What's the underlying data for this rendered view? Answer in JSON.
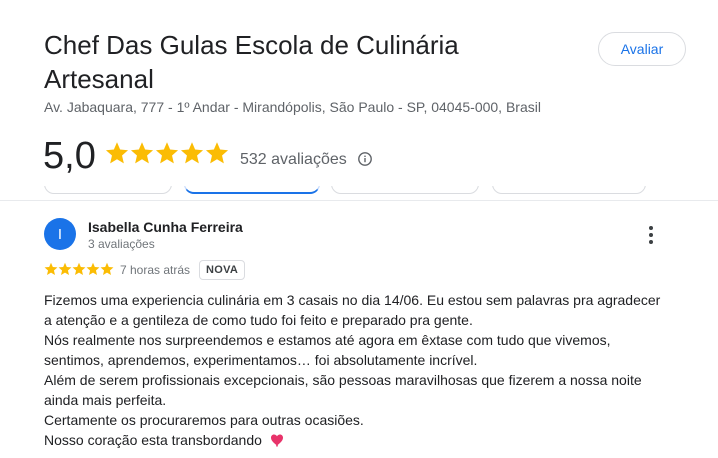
{
  "place": {
    "name_line1": "Chef Das Gulas Escola de Culinária",
    "name_line2": "Artesanal",
    "address": "Av. Jabaquara, 777 - 1º Andar - Mirandópolis, São Paulo - SP, 04045-000, Brasil",
    "rate_button_label": "Avaliar"
  },
  "rating": {
    "score": "5,0",
    "stars": 5,
    "count_label": "532 avaliações",
    "star_color": "#fbbc04"
  },
  "review": {
    "avatar_letter": "I",
    "avatar_color": "#1a73e8",
    "reviewer_name": "Isabella Cunha Ferreira",
    "reviewer_reviews": "3 avaliações",
    "stars": 5,
    "time": "7 horas atrás",
    "badge": "NOVA",
    "lines": [
      "Fizemos uma experiencia culinária em 3 casais no dia 14/06. Eu estou sem palavras pra agradecer",
      "a atenção e a gentileza de como tudo foi feito e preparado pra gente.",
      "Nós realmente nos surpreendemos e estamos até agora em êxtase com tudo que vivemos,",
      "sentimos, aprendemos, experimentamos… foi absolutamente incrível.",
      "Além de serem profissionais excepcionais, são pessoas maravilhosas que fizerem a nossa noite",
      "ainda mais perfeita.",
      "Certamente os procuraremos para outras ocasiões.",
      "Nosso coração esta transbordando"
    ],
    "emoji": "heart-icon"
  },
  "icons": {
    "info": "info-icon",
    "more": "more-vert-icon",
    "star": "star-icon"
  },
  "colors": {
    "accent": "#1a73e8",
    "heart": "#e8336a"
  }
}
